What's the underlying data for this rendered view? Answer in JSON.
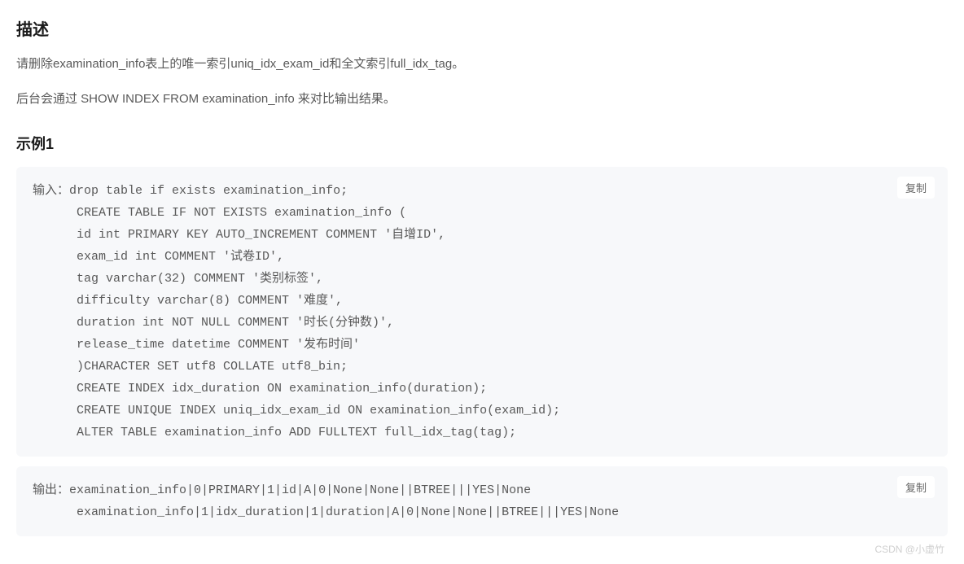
{
  "section": {
    "title": "描述",
    "desc_line1": "请删除examination_info表上的唯一索引uniq_idx_exam_id和全文索引full_idx_tag。",
    "desc_line2": "后台会通过 SHOW INDEX FROM examination_info 来对比输出结果。"
  },
  "example": {
    "title": "示例1",
    "input_label": "输入：",
    "output_label": "输出：",
    "copy_label": "复制",
    "input_code": "drop table if exists examination_info;\n      CREATE TABLE IF NOT EXISTS examination_info (\n      id int PRIMARY KEY AUTO_INCREMENT COMMENT '自增ID',\n      exam_id int COMMENT '试卷ID',\n      tag varchar(32) COMMENT '类别标签',\n      difficulty varchar(8) COMMENT '难度',\n      duration int NOT NULL COMMENT '时长(分钟数)',\n      release_time datetime COMMENT '发布时间'\n      )CHARACTER SET utf8 COLLATE utf8_bin;\n      CREATE INDEX idx_duration ON examination_info(duration);\n      CREATE UNIQUE INDEX uniq_idx_exam_id ON examination_info(exam_id);\n      ALTER TABLE examination_info ADD FULLTEXT full_idx_tag(tag);",
    "output_code": "examination_info|0|PRIMARY|1|id|A|0|None|None||BTREE|||YES|None\n      examination_info|1|idx_duration|1|duration|A|0|None|None||BTREE|||YES|None"
  },
  "watermark": "CSDN @小虚竹"
}
